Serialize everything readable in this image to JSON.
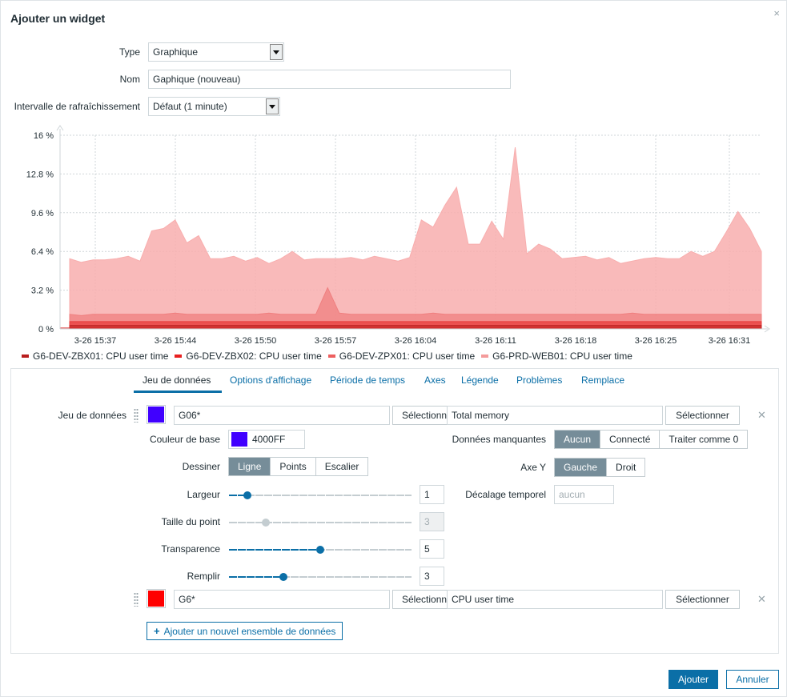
{
  "dialog": {
    "title": "Ajouter un widget",
    "close_icon": "×"
  },
  "form": {
    "type_label": "Type",
    "type_value": "Graphique",
    "name_label": "Nom",
    "name_value": "Gaphique (nouveau)",
    "refresh_label": "Intervalle de rafraîchissement",
    "refresh_value": "Défaut (1 minute)"
  },
  "chart": {
    "y_ticks": [
      "16 %",
      "12.8 %",
      "9.6 %",
      "6.4 %",
      "3.2 %",
      "0 %"
    ],
    "x_ticks": [
      "3-26 15:37",
      "3-26 15:44",
      "3-26 15:50",
      "3-26 15:57",
      "3-26 16:04",
      "3-26 16:11",
      "3-26 16:18",
      "3-26 16:25",
      "3-26 16:31"
    ],
    "legend": [
      {
        "label": "G6-DEV-ZBX01: CPU user time",
        "color": "#b81d1d"
      },
      {
        "label": "G6-DEV-ZBX02: CPU user time",
        "color": "#e82020"
      },
      {
        "label": "G6-DEV-ZPX01: CPU user time",
        "color": "#ed5f5f"
      },
      {
        "label": "G6-PRD-WEB01: CPU user time",
        "color": "#f49b9b"
      }
    ]
  },
  "chart_data": {
    "type": "area",
    "ylim": [
      0,
      16
    ],
    "y_unit": "%",
    "x": [
      "3-26 15:37",
      "3-26 15:44",
      "3-26 15:50",
      "3-26 15:57",
      "3-26 16:04",
      "3-26 16:11",
      "3-26 16:18",
      "3-26 16:25",
      "3-26 16:31"
    ],
    "series": [
      {
        "name": "G6-PRD-WEB01: CPU user time",
        "color": "#f8aeae",
        "values": [
          5.8,
          5.5,
          5.7,
          5.7,
          5.8,
          6.0,
          5.6,
          8.1,
          8.3,
          9.0,
          7.1,
          7.7,
          5.8,
          5.8,
          6.0,
          5.6,
          5.9,
          5.4,
          5.8,
          6.4,
          5.7,
          5.8,
          5.8,
          5.8,
          5.9,
          5.7,
          6.0,
          5.8,
          5.6,
          5.9,
          9.0,
          8.4,
          10.2,
          11.7,
          7.0,
          7.0,
          8.9,
          7.4,
          15.0,
          6.2,
          7.0,
          6.6,
          5.8,
          5.9,
          6.0,
          5.7,
          5.9,
          5.4,
          5.6,
          5.8,
          5.9,
          5.8,
          5.8,
          6.4,
          6.0,
          6.4,
          8.0,
          9.7,
          8.3,
          6.4
        ]
      },
      {
        "name": "G6-DEV-ZPX01: CPU user time",
        "color": "#ef7f7f",
        "values": [
          1.2,
          1.1,
          1.2,
          1.2,
          1.2,
          1.2,
          1.2,
          1.2,
          1.2,
          1.3,
          1.2,
          1.2,
          1.2,
          1.2,
          1.2,
          1.2,
          1.2,
          1.3,
          1.2,
          1.2,
          1.2,
          1.2,
          3.4,
          1.3,
          1.2,
          1.2,
          1.2,
          1.2,
          1.2,
          1.2,
          1.2,
          1.3,
          1.2,
          1.2,
          1.2,
          1.2,
          1.2,
          1.2,
          1.2,
          1.2,
          1.2,
          1.2,
          1.2,
          1.2,
          1.2,
          1.2,
          1.2,
          1.2,
          1.3,
          1.2,
          1.2,
          1.2,
          1.2,
          1.2,
          1.2,
          1.2,
          1.2,
          1.2,
          1.2,
          1.2
        ]
      },
      {
        "name": "G6-DEV-ZBX02: CPU user time",
        "color": "#e83c3c",
        "values": [
          0.6,
          0.6,
          0.6,
          0.6,
          0.6,
          0.6,
          0.6,
          0.6,
          0.6,
          0.6,
          0.6,
          0.6,
          0.6,
          0.6,
          0.6,
          0.6,
          0.6,
          0.6,
          0.6,
          0.6,
          0.6,
          0.6,
          0.6,
          0.6,
          0.6,
          0.6,
          0.6,
          0.6,
          0.6,
          0.6,
          0.6,
          0.6,
          0.6,
          0.6,
          0.6,
          0.6,
          0.6,
          0.6,
          0.6,
          0.6,
          0.6,
          0.6,
          0.6,
          0.6,
          0.6,
          0.6,
          0.6,
          0.6,
          0.6,
          0.6,
          0.6,
          0.6,
          0.6,
          0.6,
          0.6,
          0.6,
          0.6,
          0.6,
          0.6,
          0.6
        ]
      },
      {
        "name": "G6-DEV-ZBX01: CPU user time",
        "color": "#c42a2a",
        "values": [
          0.3,
          0.3,
          0.3,
          0.3,
          0.3,
          0.3,
          0.3,
          0.3,
          0.3,
          0.3,
          0.3,
          0.3,
          0.3,
          0.3,
          0.3,
          0.3,
          0.3,
          0.3,
          0.3,
          0.3,
          0.3,
          0.3,
          0.3,
          0.3,
          0.3,
          0.3,
          0.3,
          0.3,
          0.3,
          0.3,
          0.3,
          0.3,
          0.3,
          0.3,
          0.3,
          0.3,
          0.3,
          0.3,
          0.3,
          0.3,
          0.3,
          0.3,
          0.3,
          0.3,
          0.3,
          0.3,
          0.3,
          0.3,
          0.3,
          0.3,
          0.3,
          0.3,
          0.3,
          0.3,
          0.3,
          0.3,
          0.3,
          0.3,
          0.3,
          0.3
        ]
      }
    ],
    "grid": true
  },
  "tabs": [
    "Jeu de données",
    "Options d'affichage",
    "Période de temps",
    "Axes",
    "Légende",
    "Problèmes",
    "Remplace"
  ],
  "dataset1": {
    "label": "Jeu de données",
    "color": "#4000FF",
    "host": "G06*",
    "select_label": "Sélectionner",
    "item": "Total memory",
    "select_label2": "Sélectionner",
    "base_color_label": "Couleur de base",
    "base_color_value": "4000FF",
    "draw_label": "Dessiner",
    "draw_options": [
      "Ligne",
      "Points",
      "Escalier"
    ],
    "width_label": "Largeur",
    "width_value": "1",
    "width_level": 0.1,
    "point_size_label": "Taille du point",
    "point_size_value": "3",
    "point_size_level": 0.2,
    "transparency_label": "Transparence",
    "transparency_value": "5",
    "transparency_level": 0.5,
    "fill_label": "Remplir",
    "fill_value": "3",
    "fill_level": 0.3,
    "missing_label": "Données manquantes",
    "missing_options": [
      "Aucun",
      "Connecté",
      "Traiter comme 0"
    ],
    "yaxis_label": "Axe Y",
    "yaxis_options": [
      "Gauche",
      "Droit"
    ],
    "timeshift_label": "Décalage temporel",
    "timeshift_placeholder": "aucun"
  },
  "dataset2": {
    "color": "#FF0000",
    "host": "G6*",
    "select_label": "Sélectionner",
    "item": "CPU user time",
    "select_label2": "Sélectionner"
  },
  "add_dataset_label": "Ajouter un nouvel ensemble de données",
  "footer": {
    "add_label": "Ajouter",
    "cancel_label": "Annuler"
  }
}
